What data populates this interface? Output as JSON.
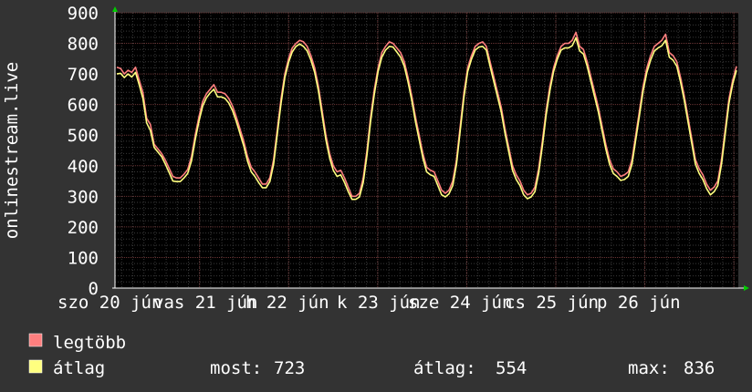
{
  "chart_data": {
    "type": "line",
    "ylabel": "onlinestream.live",
    "ylim": [
      0,
      900
    ],
    "yticks": [
      "900",
      "800",
      "700",
      "600",
      "500",
      "400",
      "300",
      "200",
      "100",
      "0"
    ],
    "xtick_labels": [
      "szo 20 jún",
      "vas 21 jún",
      "h 22 jún",
      "k 23 jún",
      "sze 24 jún",
      "cs 25 jún",
      "p 26 jún"
    ],
    "grid": true,
    "series": [
      {
        "name": "legtöbb",
        "color": "#ff7f7f",
        "values": [
          722,
          718,
          700,
          712,
          705,
          722,
          680,
          640,
          555,
          535,
          470,
          455,
          440,
          418,
          392,
          365,
          360,
          360,
          372,
          388,
          430,
          500,
          560,
          610,
          635,
          650,
          665,
          640,
          640,
          635,
          620,
          595,
          560,
          520,
          480,
          430,
          395,
          380,
          360,
          340,
          340,
          360,
          420,
          520,
          620,
          700,
          750,
          785,
          800,
          810,
          805,
          790,
          760,
          720,
          660,
          580,
          500,
          440,
          400,
          380,
          385,
          360,
          330,
          300,
          300,
          310,
          360,
          450,
          560,
          650,
          720,
          770,
          790,
          805,
          800,
          785,
          770,
          740,
          690,
          630,
          560,
          500,
          440,
          395,
          385,
          380,
          350,
          320,
          310,
          320,
          350,
          420,
          530,
          640,
          720,
          760,
          790,
          800,
          805,
          790,
          740,
          690,
          640,
          590,
          520,
          460,
          400,
          370,
          350,
          320,
          305,
          310,
          330,
          390,
          480,
          580,
          660,
          720,
          760,
          790,
          800,
          800,
          810,
          836,
          790,
          780,
          740,
          690,
          640,
          590,
          530,
          470,
          420,
          390,
          380,
          365,
          370,
          380,
          420,
          500,
          580,
          660,
          720,
          760,
          790,
          800,
          810,
          830,
          770,
          760,
          740,
          690,
          630,
          560,
          490,
          420,
          390,
          370,
          340,
          320,
          330,
          350,
          420,
          520,
          620,
          680,
          725
        ]
      },
      {
        "name": "átlag",
        "color": "#ffff7f",
        "values": [
          700,
          702,
          688,
          700,
          690,
          705,
          665,
          620,
          540,
          515,
          460,
          445,
          430,
          405,
          378,
          350,
          348,
          348,
          360,
          375,
          415,
          485,
          545,
          595,
          622,
          638,
          650,
          625,
          625,
          620,
          605,
          580,
          545,
          505,
          465,
          415,
          380,
          365,
          345,
          328,
          328,
          348,
          405,
          505,
          605,
          688,
          738,
          772,
          790,
          798,
          790,
          775,
          745,
          705,
          645,
          565,
          485,
          425,
          385,
          365,
          370,
          345,
          315,
          290,
          290,
          298,
          345,
          435,
          545,
          635,
          708,
          755,
          778,
          790,
          788,
          772,
          755,
          725,
          675,
          615,
          545,
          485,
          425,
          380,
          370,
          365,
          335,
          305,
          298,
          308,
          335,
          405,
          515,
          625,
          708,
          748,
          778,
          788,
          790,
          778,
          725,
          675,
          625,
          575,
          505,
          445,
          385,
          355,
          335,
          305,
          292,
          298,
          315,
          375,
          465,
          565,
          645,
          708,
          748,
          778,
          785,
          785,
          792,
          818,
          775,
          765,
          725,
          675,
          625,
          575,
          515,
          455,
          405,
          375,
          365,
          352,
          355,
          365,
          405,
          485,
          565,
          645,
          705,
          745,
          775,
          785,
          792,
          810,
          755,
          745,
          725,
          675,
          615,
          545,
          475,
          405,
          375,
          355,
          325,
          305,
          315,
          335,
          405,
          505,
          605,
          668,
          712
        ]
      }
    ],
    "stats": [
      {
        "label": "most:",
        "value": "723"
      },
      {
        "label": "átlag:",
        "value": "554"
      },
      {
        "label": "max:",
        "value": "836"
      }
    ]
  },
  "colors": {
    "background": "#333333",
    "plot_background": "#000000",
    "axis": "#ffffff",
    "arrow": "#00cc00"
  }
}
